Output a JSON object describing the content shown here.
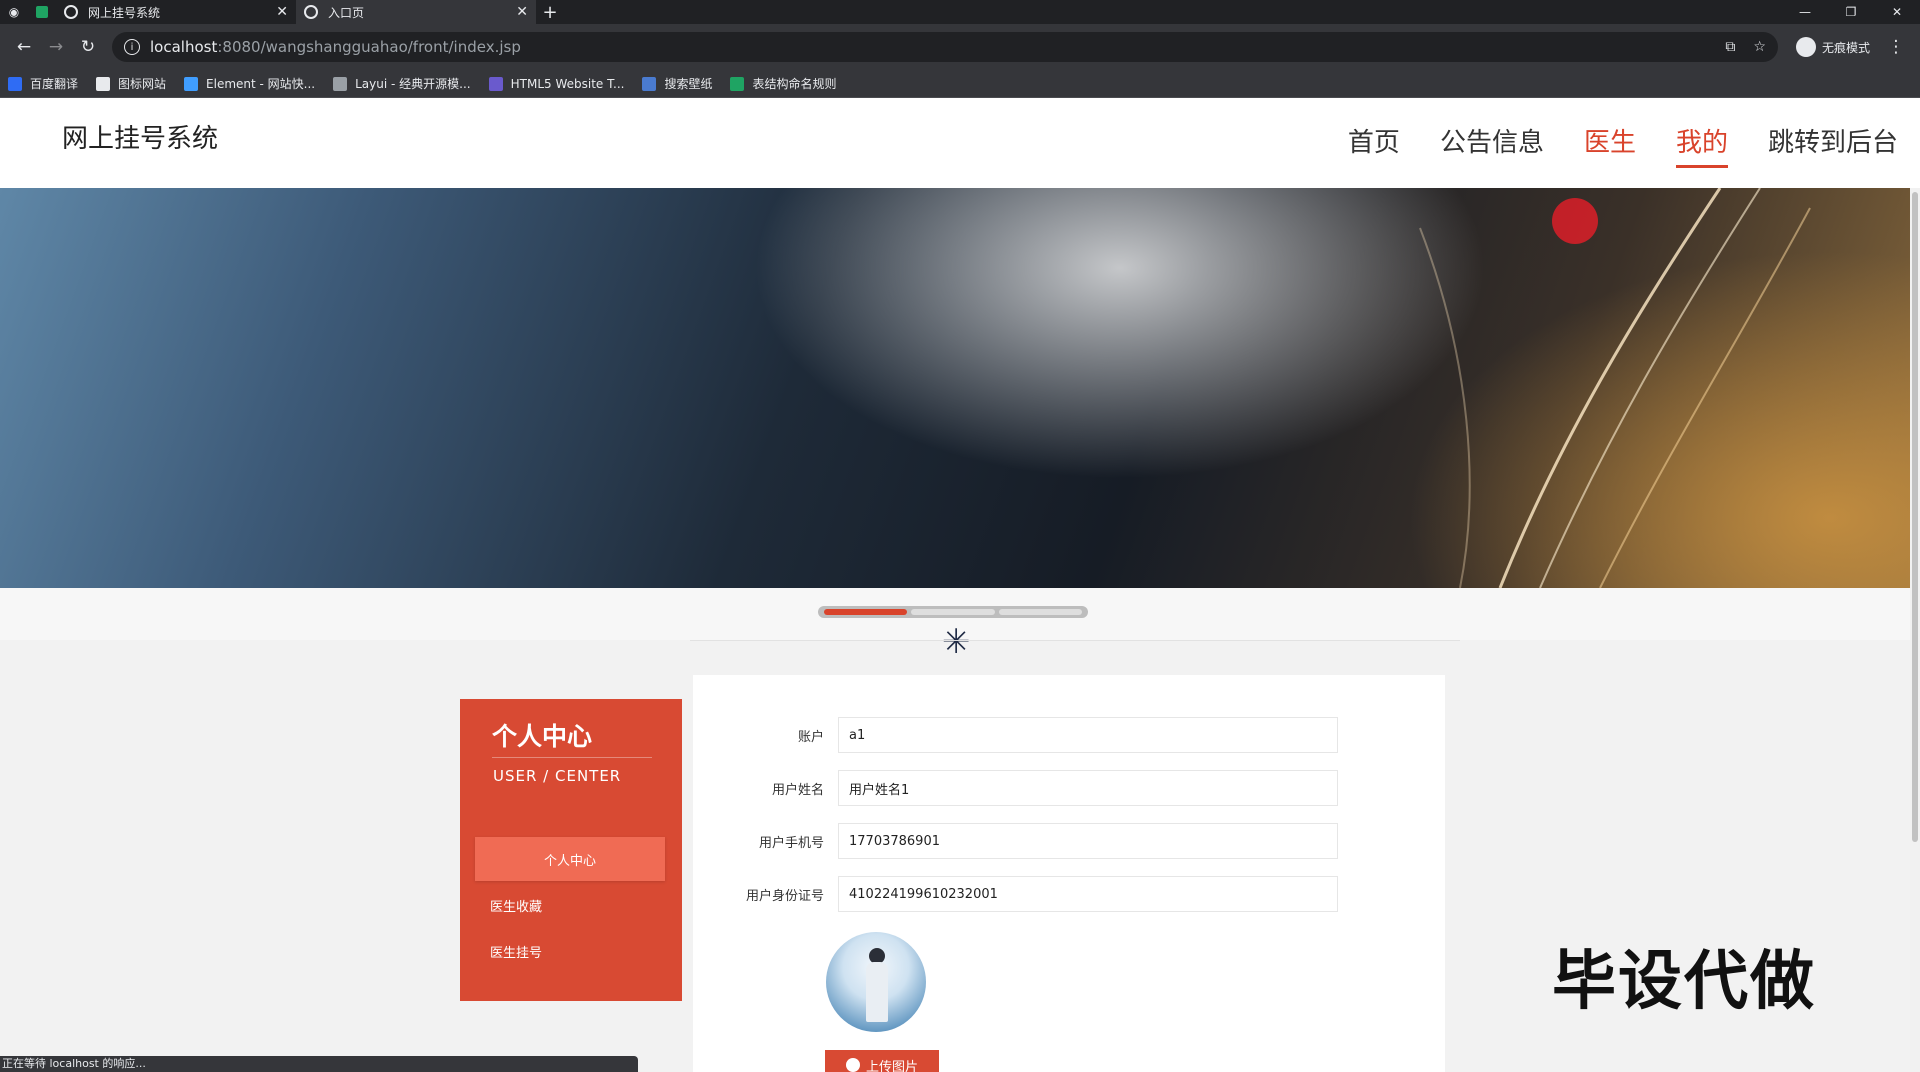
{
  "browser": {
    "tabs": [
      {
        "title": "网上挂号系统",
        "active": false
      },
      {
        "title": "入口页",
        "active": true
      }
    ],
    "address": {
      "host": "localhost",
      "path": ":8080/wangshangguahao/front/index.jsp"
    },
    "profile_label": "无痕模式",
    "bookmarks": [
      {
        "label": "百度翻译",
        "color": "#2f6cf4"
      },
      {
        "label": "图标网站",
        "color": "#e8eaed"
      },
      {
        "label": "Element - 网站快...",
        "color": "#409eff"
      },
      {
        "label": "Layui - 经典开源模...",
        "color": "#9aa0a6"
      },
      {
        "label": "HTML5 Website T...",
        "color": "#6a5acd"
      },
      {
        "label": "搜索壁纸",
        "color": "#4a7bd0"
      },
      {
        "label": "表结构命名规则",
        "color": "#1fa463"
      }
    ],
    "status_text": "正在等待 localhost 的响应..."
  },
  "site": {
    "logo": "网上挂号系统",
    "nav": [
      {
        "label": "首页",
        "state": "normal"
      },
      {
        "label": "公告信息",
        "state": "normal"
      },
      {
        "label": "医生",
        "state": "red"
      },
      {
        "label": "我的",
        "state": "current"
      },
      {
        "label": "跳转到后台",
        "state": "normal"
      }
    ]
  },
  "sidebar": {
    "title": "个人中心",
    "subtitle": "USER / CENTER",
    "items": [
      {
        "label": "个人中心",
        "active": true
      },
      {
        "label": "医生收藏",
        "active": false
      },
      {
        "label": "医生挂号",
        "active": false
      }
    ]
  },
  "form": {
    "fields": [
      {
        "label": "账户",
        "value": "a1"
      },
      {
        "label": "用户姓名",
        "value": "用户姓名1"
      },
      {
        "label": "用户手机号",
        "value": "17703786901"
      },
      {
        "label": "用户身份证号",
        "value": "410224199610232001"
      }
    ],
    "upload_label": "上传图片"
  },
  "watermark": "毕设代做"
}
